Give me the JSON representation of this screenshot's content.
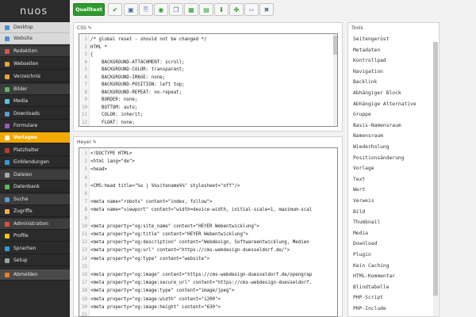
{
  "app": {
    "logo": "nuos"
  },
  "sidebar": {
    "items": [
      {
        "label": "Desktop",
        "style": "light",
        "color": "#4a90d9"
      },
      {
        "label": "Website",
        "style": "light",
        "color": "#4a90d9"
      },
      {
        "label": "Redaktion",
        "style": "section",
        "color": "#d9534f"
      },
      {
        "label": "Webseiten",
        "style": "normal",
        "color": "#e8a33a"
      },
      {
        "label": "Verzeichnis",
        "style": "normal",
        "color": "#e8a33a"
      },
      {
        "label": "Bilder",
        "style": "section",
        "color": "#5cb85c"
      },
      {
        "label": "Media",
        "style": "normal",
        "color": "#5bc0de"
      },
      {
        "label": "Downloads",
        "style": "normal",
        "color": "#5b9bd5"
      },
      {
        "label": "Formulare",
        "style": "normal",
        "color": "#9b59b6"
      },
      {
        "label": "Vorlagen",
        "style": "active",
        "color": "#ffffff"
      },
      {
        "label": "Platzhalter",
        "style": "normal",
        "color": "#c0392b"
      },
      {
        "label": "Einblendungen",
        "style": "normal",
        "color": "#3498db"
      },
      {
        "label": "Dateien",
        "style": "section",
        "color": "#aaaaaa"
      },
      {
        "label": "Datenbank",
        "style": "normal",
        "color": "#5cb85c"
      },
      {
        "label": "Suche",
        "style": "section",
        "color": "#5b9bd5"
      },
      {
        "label": "Zugriffe",
        "style": "normal",
        "color": "#f0ad4e"
      },
      {
        "label": "Administration",
        "style": "section",
        "color": "#e74c3c"
      },
      {
        "label": "Profile",
        "style": "normal",
        "color": "#f1c40f"
      },
      {
        "label": "Sprachen",
        "style": "normal",
        "color": "#3498db"
      },
      {
        "label": "Setup",
        "style": "normal",
        "color": "#95a5a6"
      },
      {
        "label": "Abmelden",
        "style": "logout",
        "color": "#e67e22"
      }
    ]
  },
  "toolbar": {
    "source_label": "Quelltext",
    "icons": [
      {
        "name": "check-icon",
        "glyph": "✔",
        "color": "#2e9e2e"
      },
      {
        "name": "save-icon",
        "glyph": "▣",
        "color": "#4a6fa5"
      },
      {
        "name": "copy-icon",
        "glyph": "⎘",
        "color": "#4a6fa5"
      },
      {
        "name": "globe-icon",
        "glyph": "◉",
        "color": "#2e9e2e"
      },
      {
        "name": "duplicate-icon",
        "glyph": "❐",
        "color": "#4a6fa5"
      },
      {
        "name": "frame-icon",
        "glyph": "▦",
        "color": "#2e9e2e"
      },
      {
        "name": "film-icon",
        "glyph": "▤",
        "color": "#2e9e2e"
      },
      {
        "name": "download-icon",
        "glyph": "⬇",
        "color": "#2e9e2e"
      },
      {
        "name": "puzzle-icon",
        "glyph": "✤",
        "color": "#2e9e2e"
      },
      {
        "name": "code-icon",
        "glyph": "‹›",
        "color": "#4a6fa5"
      },
      {
        "name": "settings-icon",
        "glyph": "✖",
        "color": "#4a6fa5"
      }
    ]
  },
  "css_panel": {
    "title": "CSS ✎",
    "lines": [
      {
        "n": "1",
        "t": "/* global reset - should not be changed */"
      },
      {
        "n": "2",
        "t": "HTML *"
      },
      {
        "n": "3",
        "t": "{"
      },
      {
        "n": "4",
        "t": "    BACKGROUND-ATTACHMENT: scroll;"
      },
      {
        "n": "5",
        "t": "    BACKGROUND-COLOR: transparent;"
      },
      {
        "n": "6",
        "t": "    BACKGROUND-IMAGE: none;"
      },
      {
        "n": "7",
        "t": "    BACKGROUND-POSITION: left top;"
      },
      {
        "n": "8",
        "t": "    BACKGROUND-REPEAT: no-repeat;"
      },
      {
        "n": "9",
        "t": "    BORDER: none;"
      },
      {
        "n": "10",
        "t": "    BOTTOM: auto;"
      },
      {
        "n": "11",
        "t": "    COLOR: inherit;"
      },
      {
        "n": "12",
        "t": "    FLOAT: none;"
      }
    ]
  },
  "header_panel": {
    "title": "Heyer ✎",
    "lines": [
      {
        "n": "1",
        "t": "<!DOCTYPE HTML>"
      },
      {
        "n": "2",
        "t": "<html lang=\"de\">"
      },
      {
        "n": "3",
        "t": "<head>"
      },
      {
        "n": "4",
        "t": ""
      },
      {
        "n": "5",
        "t": "<CMS:head title=\"%s | %%sitename%%\" stylesheet=\"off\"/>"
      },
      {
        "n": "6",
        "t": ""
      },
      {
        "n": "7",
        "t": "<meta name=\"robots\" content=\"index, follow\">"
      },
      {
        "n": "8",
        "t": "<meta name=\"viewport\" content=\"width=device-width, initial-scale=1, maximum-scal"
      },
      {
        "n": "9",
        "t": ""
      },
      {
        "n": "10",
        "t": "<meta property=\"og:site_name\" content=\"HEYER Webentwicklung\">"
      },
      {
        "n": "11",
        "t": "<meta property=\"og:title\" content=\"HEYER Webentwicklung\">"
      },
      {
        "n": "12",
        "t": "<meta property=\"og:description\" content=\"Webdesign, Softwareentwicklung, Medien"
      },
      {
        "n": "13",
        "t": "<meta property=\"og:url\" content=\"https://cms-webdesign-duesseldorf.de/\">"
      },
      {
        "n": "14",
        "t": "<meta property=\"og:type\" content=\"website\">"
      },
      {
        "n": "15",
        "t": ""
      },
      {
        "n": "16",
        "t": "<meta property=\"og:image\" content=\"https://cms-webdesign-duesseldorf.de/opengrap"
      },
      {
        "n": "17",
        "t": "<meta property=\"og:image:secure_url\" content=\"https://cms-webdesign-duesseldorf."
      },
      {
        "n": "18",
        "t": "<meta property=\"og:image:type\" content=\"image/jpeg\">"
      },
      {
        "n": "19",
        "t": "<meta property=\"og:image:width\" content=\"1200\">"
      },
      {
        "n": "20",
        "t": "<meta property=\"og:image:height\" content=\"630\">"
      },
      {
        "n": "21",
        "t": ""
      }
    ]
  },
  "tools_panel": {
    "title": "Tools",
    "items": [
      "Seitengerüst",
      "Metadaten",
      "Kontrollpad",
      "Navigation",
      "Backlink",
      "Abhängiger Block",
      "Abhängige Alternative",
      "Gruppe",
      "Basis-Namensraum",
      "Namensraum",
      "Wiederholung",
      "Positionsänderung",
      "Vorlage",
      "Text",
      "Wert",
      "Verweis",
      "Bild",
      "Thumbnail",
      "Media",
      "Download",
      "Plugin",
      "Kein Caching",
      "HTML-Kommentar",
      "Blindtabelle",
      "PHP-Script",
      "PHP-Include"
    ]
  }
}
